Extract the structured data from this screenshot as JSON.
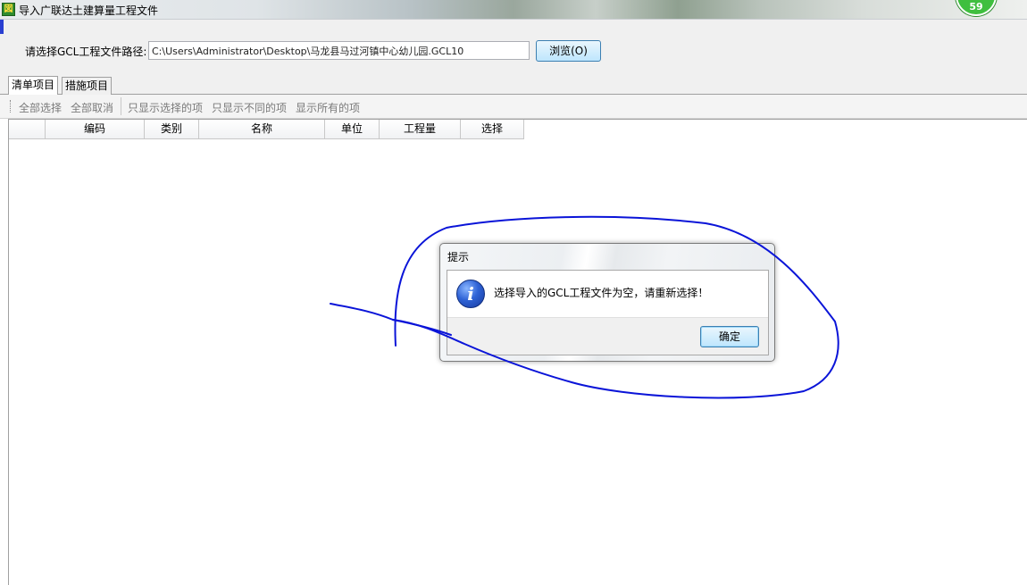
{
  "window": {
    "title": "导入广联达土建算量工程文件",
    "app_icon_glyph": "図",
    "badge_count": "59"
  },
  "path_row": {
    "label": "请选择GCL工程文件路径:",
    "value": "C:\\Users\\Administrator\\Desktop\\马龙县马过河镇中心幼儿园.GCL10",
    "browse_label": "浏览(O)"
  },
  "tabs": [
    {
      "label": "清单项目",
      "active": true
    },
    {
      "label": "措施项目",
      "active": false
    }
  ],
  "toolbar": {
    "select_all": "全部选择",
    "deselect_all": "全部取消",
    "show_selected": "只显示选择的项",
    "show_different": "只显示不同的项",
    "show_all": "显示所有的项"
  },
  "grid": {
    "columns": [
      "",
      "编码",
      "类别",
      "名称",
      "单位",
      "工程量",
      "选择"
    ]
  },
  "dialog": {
    "title": "提示",
    "icon": "info-icon",
    "icon_glyph": "i",
    "message": "选择导入的GCL工程文件为空，请重新选择！",
    "ok_label": "确定"
  },
  "colors": {
    "annotation": "#0a14d8",
    "button_border": "#3c7fb1",
    "info_icon": "#2f63d6"
  }
}
